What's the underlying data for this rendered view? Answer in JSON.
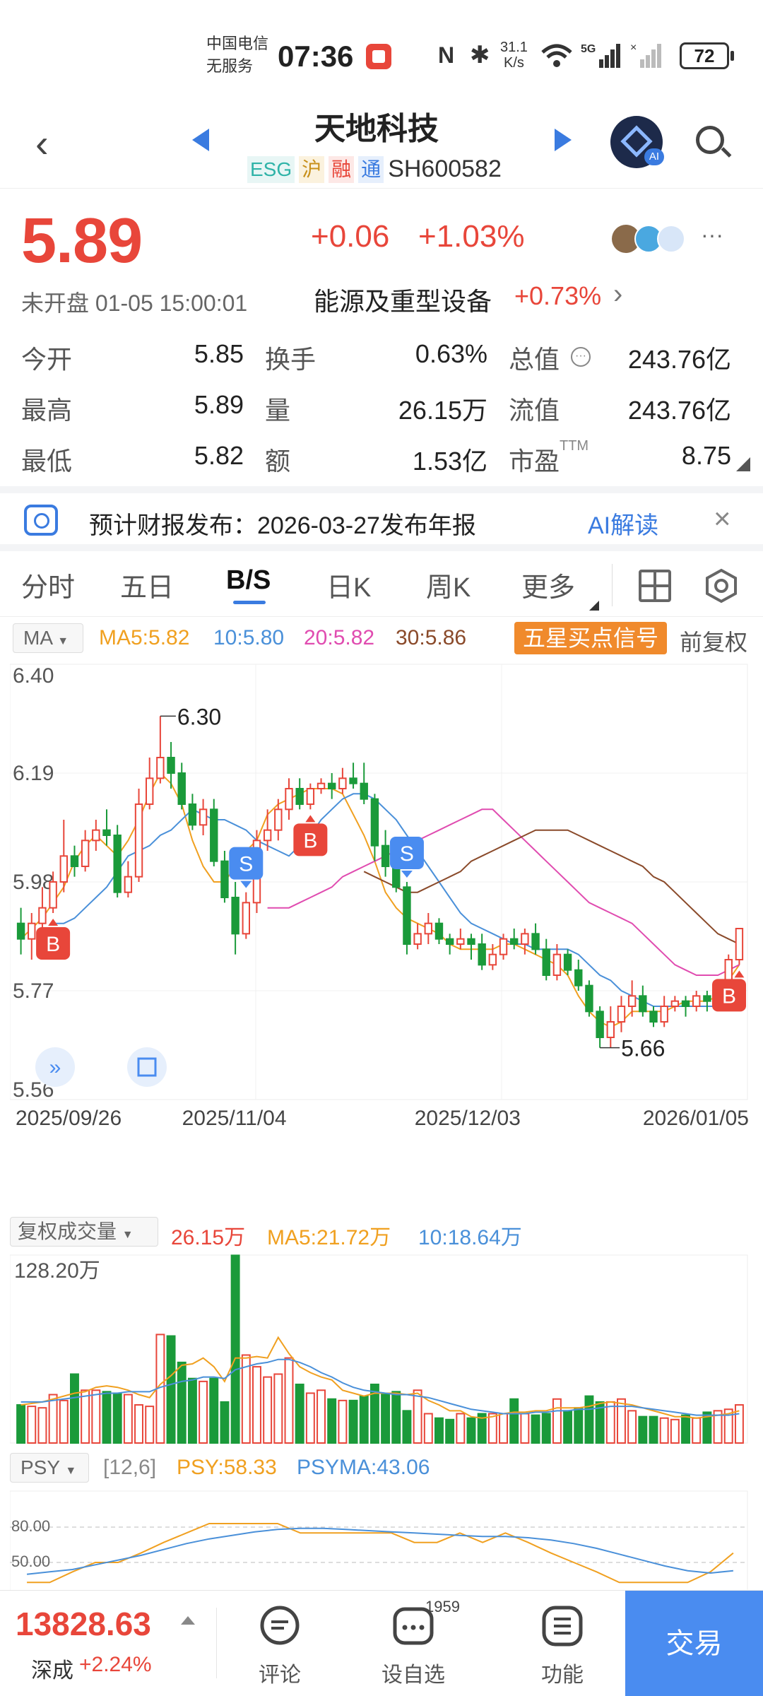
{
  "status_bar": {
    "carrier": "中国电信",
    "carrier_sub": "无服务",
    "time": "07:36",
    "net_speed_top": "31.1",
    "net_speed_bottom": "K/s",
    "battery": "72"
  },
  "header": {
    "title": "天地科技",
    "tags": [
      "ESG",
      "沪",
      "融",
      "通"
    ],
    "code": "SH600582"
  },
  "quote": {
    "price": "5.89",
    "change": "+0.06",
    "change_pct": "+1.03%",
    "status": "未开盘 01-05 15:00:01",
    "sector": "能源及重型设备",
    "sector_pct": "+0.73%",
    "more": "···"
  },
  "stats": [
    {
      "label": "今开",
      "value": "5.85",
      "color": "red"
    },
    {
      "label": "换手",
      "value": "0.63%",
      "color": "black"
    },
    {
      "label": "总值",
      "value": "243.76亿",
      "color": "black"
    },
    {
      "label": "最高",
      "value": "5.89",
      "color": "red"
    },
    {
      "label": "量",
      "value": "26.15万",
      "color": "black"
    },
    {
      "label": "流值",
      "value": "243.76亿",
      "color": "black"
    },
    {
      "label": "最低",
      "value": "5.82",
      "color": "green"
    },
    {
      "label": "额",
      "value": "1.53亿",
      "color": "black"
    },
    {
      "label": "市盈",
      "value": "8.75",
      "color": "black",
      "sup": "TTM"
    }
  ],
  "banner": {
    "text": "预计财报发布：2026-03-27发布年报",
    "ai_label": "AI解读"
  },
  "tabs": [
    "分时",
    "五日",
    "B/S",
    "日K",
    "周K",
    "更多"
  ],
  "active_tab": "B/S",
  "ma_legend": {
    "selector": "MA",
    "ma5": "MA5:5.82",
    "ma10": "10:5.80",
    "ma20": "20:5.82",
    "ma30": "30:5.86",
    "signal": "五星买点信号",
    "adjust": "前复权"
  },
  "chart_data": [
    {
      "type": "candlestick",
      "title": "",
      "y_ticks": [
        "6.40",
        "6.19",
        "5.98",
        "5.77",
        "5.56"
      ],
      "ylim": [
        5.56,
        6.4
      ],
      "x_ticks": [
        "2025/09/26",
        "2025/11/04",
        "2025/12/03",
        "2026/01/05"
      ],
      "annotations": [
        {
          "label": "6.30",
          "note": "high"
        },
        {
          "label": "5.66",
          "note": "low"
        },
        {
          "label": "B"
        },
        {
          "label": "S"
        },
        {
          "label": "B"
        },
        {
          "label": "S"
        },
        {
          "label": "B"
        }
      ],
      "candles": [
        [
          5.9,
          5.87,
          5.93,
          5.84
        ],
        [
          5.87,
          5.9,
          5.92,
          5.83
        ],
        [
          5.9,
          5.93,
          5.97,
          5.89
        ],
        [
          5.93,
          5.98,
          6.0,
          5.92
        ],
        [
          5.98,
          6.03,
          6.1,
          5.96
        ],
        [
          6.03,
          6.01,
          6.05,
          5.99
        ],
        [
          6.01,
          6.06,
          6.08,
          6.0
        ],
        [
          6.06,
          6.08,
          6.1,
          6.04
        ],
        [
          6.08,
          6.07,
          6.12,
          6.05
        ],
        [
          6.07,
          5.96,
          6.09,
          5.95
        ],
        [
          5.96,
          5.99,
          6.02,
          5.95
        ],
        [
          5.99,
          6.13,
          6.16,
          5.98
        ],
        [
          6.13,
          6.18,
          6.22,
          6.12
        ],
        [
          6.18,
          6.22,
          6.3,
          6.17
        ],
        [
          6.22,
          6.19,
          6.25,
          6.16
        ],
        [
          6.19,
          6.13,
          6.21,
          6.12
        ],
        [
          6.13,
          6.09,
          6.15,
          6.08
        ],
        [
          6.09,
          6.12,
          6.14,
          6.07
        ],
        [
          6.12,
          6.02,
          6.14,
          6.01
        ],
        [
          6.02,
          5.95,
          6.04,
          5.94
        ],
        [
          5.95,
          5.88,
          5.98,
          5.84
        ],
        [
          5.88,
          5.94,
          5.96,
          5.87
        ],
        [
          5.94,
          6.06,
          6.08,
          5.92
        ],
        [
          6.06,
          6.08,
          6.12,
          6.04
        ],
        [
          6.08,
          6.12,
          6.14,
          6.06
        ],
        [
          6.12,
          6.16,
          6.18,
          6.1
        ],
        [
          6.16,
          6.13,
          6.18,
          6.12
        ],
        [
          6.13,
          6.16,
          6.17,
          6.12
        ],
        [
          6.16,
          6.17,
          6.18,
          6.15
        ],
        [
          6.17,
          6.16,
          6.19,
          6.14
        ],
        [
          6.16,
          6.18,
          6.2,
          6.15
        ],
        [
          6.18,
          6.17,
          6.21,
          6.16
        ],
        [
          6.17,
          6.14,
          6.21,
          6.13
        ],
        [
          6.14,
          6.05,
          6.15,
          6.02
        ],
        [
          6.05,
          6.01,
          6.08,
          5.99
        ],
        [
          6.01,
          5.97,
          6.03,
          5.96
        ],
        [
          5.97,
          5.86,
          5.98,
          5.84
        ],
        [
          5.86,
          5.88,
          5.9,
          5.85
        ],
        [
          5.88,
          5.9,
          5.92,
          5.86
        ],
        [
          5.9,
          5.87,
          5.91,
          5.86
        ],
        [
          5.87,
          5.86,
          5.88,
          5.84
        ],
        [
          5.86,
          5.87,
          5.89,
          5.85
        ],
        [
          5.87,
          5.86,
          5.88,
          5.83
        ],
        [
          5.86,
          5.82,
          5.88,
          5.81
        ],
        [
          5.82,
          5.84,
          5.86,
          5.81
        ],
        [
          5.84,
          5.87,
          5.88,
          5.83
        ],
        [
          5.87,
          5.86,
          5.89,
          5.85
        ],
        [
          5.86,
          5.88,
          5.89,
          5.84
        ],
        [
          5.88,
          5.85,
          5.9,
          5.84
        ],
        [
          5.85,
          5.8,
          5.87,
          5.79
        ],
        [
          5.8,
          5.84,
          5.86,
          5.79
        ],
        [
          5.84,
          5.81,
          5.85,
          5.8
        ],
        [
          5.81,
          5.78,
          5.83,
          5.77
        ],
        [
          5.78,
          5.73,
          5.79,
          5.72
        ],
        [
          5.73,
          5.68,
          5.74,
          5.66
        ],
        [
          5.68,
          5.71,
          5.74,
          5.66
        ],
        [
          5.71,
          5.74,
          5.76,
          5.69
        ],
        [
          5.74,
          5.76,
          5.79,
          5.72
        ],
        [
          5.76,
          5.73,
          5.78,
          5.72
        ],
        [
          5.73,
          5.71,
          5.74,
          5.7
        ],
        [
          5.71,
          5.74,
          5.76,
          5.7
        ],
        [
          5.74,
          5.75,
          5.76,
          5.73
        ],
        [
          5.75,
          5.74,
          5.76,
          5.72
        ],
        [
          5.74,
          5.76,
          5.77,
          5.73
        ],
        [
          5.76,
          5.75,
          5.77,
          5.73
        ],
        [
          5.75,
          5.77,
          5.78,
          5.74
        ],
        [
          5.77,
          5.83,
          5.84,
          5.76
        ],
        [
          5.83,
          5.89,
          5.89,
          5.82
        ]
      ],
      "ma_series": [
        {
          "name": "MA5",
          "color": "#f0a020",
          "values": [
            5.87,
            5.89,
            5.91,
            5.94,
            5.97,
            6.02,
            6.05,
            6.07,
            6.05,
            6.03,
            6.06,
            6.1,
            6.15,
            6.19,
            6.17,
            6.13,
            6.06,
            6.01,
            5.98,
            5.98,
            6.01,
            6.04,
            6.06,
            6.11,
            6.13,
            6.14,
            6.15,
            6.16,
            6.16,
            6.16,
            6.15,
            6.11,
            6.07,
            6.02,
            5.96,
            5.93,
            5.91,
            5.9,
            5.89,
            5.88,
            5.86,
            5.85,
            5.85,
            5.85,
            5.85,
            5.86,
            5.86,
            5.85,
            5.84,
            5.83,
            5.82,
            5.8,
            5.76,
            5.73,
            5.71,
            5.7,
            5.71,
            5.73,
            5.73,
            5.73,
            5.73,
            5.74,
            5.75,
            5.75,
            5.75,
            5.76,
            5.79,
            5.82
          ]
        },
        {
          "name": "MA10",
          "color": "#4a90d9",
          "values": [
            5.9,
            5.9,
            5.91,
            5.93,
            5.95,
            5.97,
            6.0,
            6.03,
            6.04,
            6.05,
            6.07,
            6.08,
            6.1,
            6.12,
            6.11,
            6.1,
            6.1,
            6.09,
            6.08,
            6.06,
            6.05,
            6.04,
            6.03,
            6.05,
            6.07,
            6.1,
            6.12,
            6.14,
            6.15,
            6.15,
            6.14,
            6.12,
            6.1,
            6.07,
            6.04,
            6.01,
            5.98,
            5.95,
            5.92,
            5.9,
            5.89,
            5.88,
            5.87,
            5.86,
            5.86,
            5.85,
            5.85,
            5.85,
            5.85,
            5.84,
            5.82,
            5.8,
            5.79,
            5.77,
            5.76,
            5.75,
            5.74,
            5.74,
            5.74,
            5.74,
            5.74,
            5.74,
            5.74,
            5.75,
            5.76
          ]
        },
        {
          "name": "MA20",
          "color": "#e04cb0",
          "values": [
            5.93,
            5.93,
            5.93,
            5.94,
            5.95,
            5.96,
            5.97,
            5.99,
            6.0,
            6.01,
            6.02,
            6.03,
            6.04,
            6.05,
            6.06,
            6.07,
            6.08,
            6.09,
            6.1,
            6.11,
            6.12,
            6.12,
            6.1,
            6.08,
            6.06,
            6.04,
            6.02,
            6.0,
            5.98,
            5.96,
            5.94,
            5.93,
            5.92,
            5.91,
            5.9,
            5.88,
            5.86,
            5.84,
            5.82,
            5.81,
            5.8,
            5.8,
            5.8,
            5.81,
            5.82
          ]
        },
        {
          "name": "MA30",
          "color": "#8a4a2a",
          "values": [
            6.0,
            5.99,
            5.98,
            5.97,
            5.96,
            5.96,
            5.97,
            5.98,
            5.99,
            6.0,
            6.02,
            6.03,
            6.04,
            6.05,
            6.06,
            6.07,
            6.08,
            6.08,
            6.08,
            6.08,
            6.07,
            6.06,
            6.05,
            6.04,
            6.03,
            6.02,
            6.01,
            5.99,
            5.98,
            5.96,
            5.94,
            5.92,
            5.9,
            5.88,
            5.87,
            5.86
          ]
        }
      ]
    },
    {
      "type": "bar",
      "title": "",
      "legend": {
        "selector": "复权成交量",
        "vol": "26.15万",
        "ma5": "MA5:21.72万",
        "ma10": "10:18.64万"
      },
      "y_max_label": "128.20万",
      "ylim": [
        0,
        128.2
      ],
      "values": [
        26,
        25,
        24,
        33,
        29,
        47,
        36,
        36,
        35,
        34,
        33,
        26,
        25,
        74,
        73,
        55,
        44,
        42,
        44,
        28,
        128,
        60,
        52,
        45,
        47,
        58,
        40,
        34,
        36,
        30,
        29,
        29,
        32,
        40,
        33,
        35,
        22,
        36,
        20,
        17,
        16,
        20,
        17,
        20,
        20,
        20,
        30,
        20,
        19,
        20,
        30,
        22,
        24,
        32,
        28,
        28,
        30,
        22,
        18,
        18,
        17,
        16,
        19,
        17,
        21,
        22,
        23,
        26
      ],
      "ma_series": [
        {
          "name": "MA5",
          "color": "#f0a020",
          "values": [
            26,
            27,
            28,
            30,
            32,
            34,
            35,
            38,
            39,
            38,
            36,
            33,
            31,
            40,
            46,
            53,
            54,
            58,
            52,
            42,
            58,
            58,
            59,
            58,
            72,
            61,
            52,
            48,
            45,
            43,
            36,
            34,
            32,
            34,
            34,
            34,
            33,
            34,
            29,
            26,
            22,
            22,
            18,
            17,
            18,
            20,
            21,
            21,
            22,
            22,
            24,
            24,
            24,
            25,
            27,
            28,
            27,
            26,
            24,
            22,
            20,
            18,
            18,
            17,
            18,
            19,
            20,
            22
          ]
        },
        {
          "name": "MA10",
          "color": "#4a90d9",
          "values": [
            28,
            28,
            28,
            29,
            30,
            31,
            32,
            33,
            34,
            34,
            35,
            35,
            35,
            38,
            40,
            42,
            43,
            45,
            45,
            44,
            50,
            52,
            54,
            55,
            57,
            57,
            55,
            52,
            48,
            45,
            41,
            38,
            36,
            35,
            34,
            33,
            33,
            32,
            31,
            29,
            27,
            25,
            23,
            22,
            21,
            20,
            20,
            20,
            21,
            21,
            22,
            22,
            23,
            23,
            24,
            25,
            25,
            25,
            24,
            23,
            22,
            21,
            20,
            19,
            19,
            19,
            19,
            20
          ]
        }
      ]
    },
    {
      "type": "line",
      "title": "",
      "legend": {
        "selector": "PSY",
        "params": "[12,6]",
        "psy": "PSY:58.33",
        "psyma": "PSYMA:43.06"
      },
      "y_ticks": [
        "80.00",
        "50.00"
      ],
      "series": [
        {
          "name": "PSY",
          "color": "#f0a020",
          "values": [
            33,
            33,
            42,
            50,
            50,
            58,
            67,
            75,
            83,
            83,
            83,
            83,
            75,
            75,
            75,
            75,
            75,
            67,
            67,
            75,
            67,
            75,
            67,
            58,
            50,
            42,
            33,
            33,
            33,
            33,
            42,
            58
          ]
        },
        {
          "name": "PSYMA",
          "color": "#4a90d9",
          "values": [
            40,
            42,
            44,
            48,
            52,
            56,
            61,
            66,
            70,
            73,
            76,
            78,
            79,
            79,
            78,
            77,
            76,
            75,
            74,
            73,
            72,
            72,
            71,
            69,
            66,
            62,
            57,
            52,
            47,
            43,
            41,
            43
          ]
        }
      ]
    }
  ],
  "bottom": {
    "index_value": "13828.63",
    "index_name": "深成",
    "index_change": "+2.24%",
    "nav": [
      {
        "label": "评论",
        "badge": ""
      },
      {
        "label": "设自选",
        "badge": "1959"
      },
      {
        "label": "功能",
        "badge": ""
      }
    ],
    "trade": "交易"
  }
}
